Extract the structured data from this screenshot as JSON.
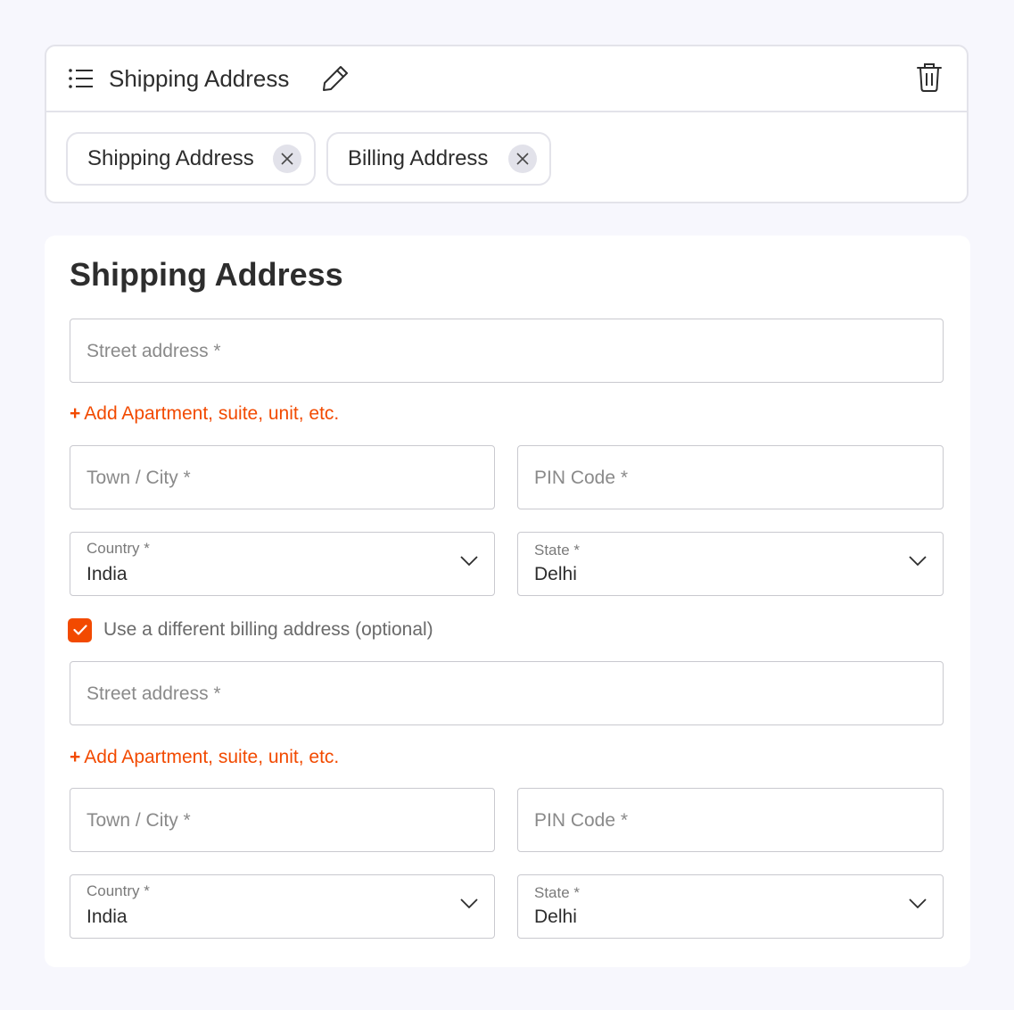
{
  "header": {
    "title": "Shipping Address",
    "chips": [
      {
        "label": "Shipping Address"
      },
      {
        "label": "Billing Address"
      }
    ]
  },
  "form": {
    "title": "Shipping Address",
    "shipping": {
      "street_placeholder": "Street address *",
      "add_apartment": "Add Apartment, suite, unit, etc.",
      "city_placeholder": "Town / City *",
      "pin_placeholder": "PIN Code *",
      "country_label": "Country *",
      "country_value": "India",
      "state_label": "State *",
      "state_value": "Delhi"
    },
    "billing_checkbox": {
      "label": "Use a different billing address (optional)",
      "checked": true
    },
    "billing": {
      "street_placeholder": "Street address *",
      "add_apartment": "Add Apartment, suite, unit, etc.",
      "city_placeholder": "Town / City *",
      "pin_placeholder": "PIN Code *",
      "country_label": "Country *",
      "country_value": "India",
      "state_label": "State *",
      "state_value": "Delhi"
    }
  },
  "icons": {
    "list": "list-icon",
    "edit": "pencil-icon",
    "delete": "trash-icon",
    "remove": "close-icon",
    "dropdown": "chevron-down-icon",
    "check": "checkmark-icon"
  },
  "colors": {
    "accent": "#f24a00",
    "background": "#f7f7fd",
    "border": "#e3e3ea"
  }
}
